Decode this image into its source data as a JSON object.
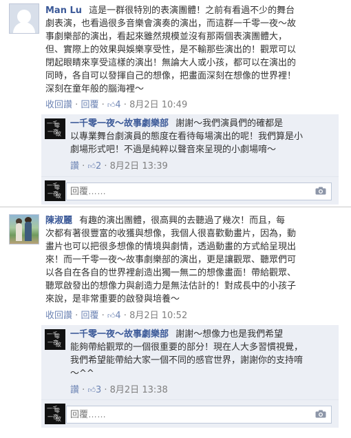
{
  "thread1": {
    "author": "Man Lu",
    "lines": [
      "這是一群很特別的表演團體！之前有看過不少的舞台",
      "劇表演，也看過很多音樂會演奏的演出，而這群一千零一夜～故",
      "事劇樂部的演出，看起來雖然規模並沒有那兩個表演團體大，",
      "但、實際上的效果與娛樂享受性，是不輸那些演出的！觀眾可以",
      "閉起眼睛來享受這樣的演出！無論大人或小孩，都可以在演出的",
      "同時，各自可以發揮自己的想像，把畫面深刻在想像的世界裡！",
      "深刻在童年般的腦海裡～"
    ],
    "actions": {
      "recall": "收回讚",
      "reply": "回覆",
      "likes": "4",
      "time": "8月2日 10:49"
    },
    "reply": {
      "author": "一千零一夜～故事劇樂部",
      "lines": [
        "謝謝～我們演員們的確都是",
        "以專業舞台劇演員的態度在看待每場演出的呢！我們算是小",
        "劇場形式吧！不過是純粹以聲音來呈現的小劇場唷～"
      ],
      "actions": {
        "like": "讚",
        "likes": "2",
        "time": "8月2日 13:39"
      }
    },
    "input_placeholder": "回覆……"
  },
  "thread2": {
    "author": "陳淑麗",
    "lines": [
      "有趣的演出團體，很高興的去聽過了幾次！而且，每",
      "次都有著很豐富的收獲與想像，我個人很喜歡動畫片，因為，動",
      "畫片也可以把很多想像的情境與劇情，透過動畫的方式給呈現出",
      "來！而一千零一夜～故事劇樂部的演出，更是讓觀眾、聽眾們可",
      "以各自在各自的世界裡創造出獨一無二的想像畫面！帶給觀眾、",
      "聽眾啟發出的想像力與創造力是無法估計的！對成長中的小孩子",
      "來說，是非常重要的啟發與培養～"
    ],
    "actions": {
      "recall": "收回讚",
      "reply": "回覆",
      "likes": "4",
      "time": "8月2日 10:52"
    },
    "reply": {
      "author": "一千零一夜～故事劇樂部",
      "lines": [
        "謝謝～想像力也是我們希望",
        "能夠帶給觀眾的一個很重要的部分！現在人大多習慣視覺，",
        "我們希望能帶給大家一個不同的感官世界，謝謝你的支持唷",
        "～^^"
      ],
      "actions": {
        "like": "讚",
        "likes": "3",
        "time": "8月2日 13:38"
      }
    },
    "input_placeholder": "回覆……"
  },
  "separator": "·",
  "like_icon": "thumbs-up-icon",
  "colors": {
    "link": "#3b5998",
    "reply_bg": "#eceff5",
    "meta": "#7f7f7f"
  }
}
